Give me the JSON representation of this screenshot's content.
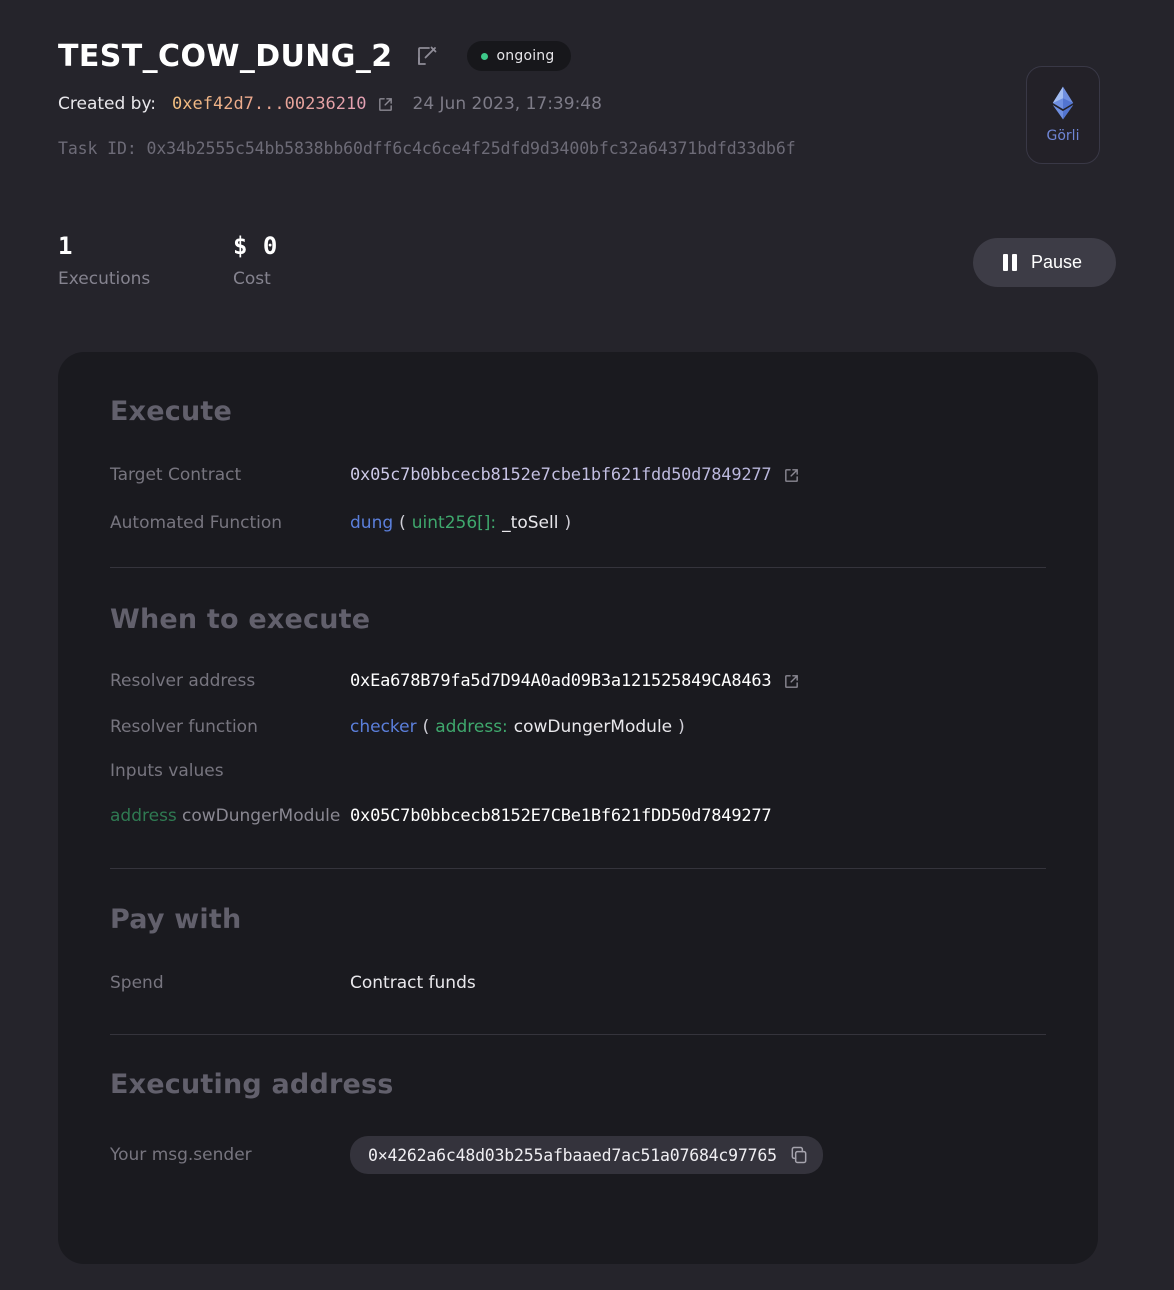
{
  "header": {
    "title": "TEST_COW_DUNG_2",
    "edit_icon": "pencil-square-icon",
    "status": {
      "label": "ongoing",
      "dot_color": "#3ec98a"
    },
    "created_by_label": "Created by:",
    "created_by_address": "0xef42d7...00236210",
    "created_by_link_icon": "external-link-icon",
    "created_date": "24 Jun 2023, 17:39:48",
    "task_id": "Task ID: 0x34b2555c54bb5838bb60dff6c4c6ce4f25dfd9d3400bfc32a64371bdfd33db6f"
  },
  "network": {
    "name": "Görli",
    "icon": "ethereum-diamond-icon",
    "color": "#6f86d6"
  },
  "stats": [
    {
      "value": "1",
      "label": "Executions"
    },
    {
      "value": "$ 0",
      "label": "Cost"
    }
  ],
  "pause_button": {
    "label": "Pause",
    "icon": "pause-icon"
  },
  "card": {
    "execute": {
      "heading": "Execute",
      "target_contract": {
        "label": "Target Contract",
        "value": "0x05c7b0bbcecb8152e7cbe1bf621fdd50d7849277",
        "link_icon": "external-link-icon"
      },
      "automated_function": {
        "label": "Automated Function",
        "name": "dung",
        "open_paren": "(",
        "param_type": "uint256[]:",
        "param_name": "_toSell",
        "close_paren": ")"
      }
    },
    "when_to_execute": {
      "heading": "When to execute",
      "resolver_address": {
        "label": "Resolver address",
        "value": "0xEa678B79fa5d7D94A0ad09B3a121525849CA8463",
        "link_icon": "external-link-icon"
      },
      "resolver_function": {
        "label": "Resolver function",
        "name": "checker",
        "open_paren": "(",
        "param_type": "address:",
        "param_name": "cowDungerModule",
        "close_paren": ")"
      },
      "inputs_values_label": "Inputs values",
      "input_row": {
        "type": "address",
        "name": "cowDungerModule",
        "value": "0x05C7b0bbcecb8152E7CBe1Bf621fDD50d7849277"
      }
    },
    "pay_with": {
      "heading": "Pay with",
      "spend": {
        "label": "Spend",
        "value": "Contract funds"
      }
    },
    "executing_address": {
      "heading": "Executing address",
      "msg_sender": {
        "label": "Your msg.sender",
        "value": "0×4262a6c48d03b255afbaaed7ac51a07684c97765",
        "copy_icon": "copy-icon"
      }
    }
  }
}
